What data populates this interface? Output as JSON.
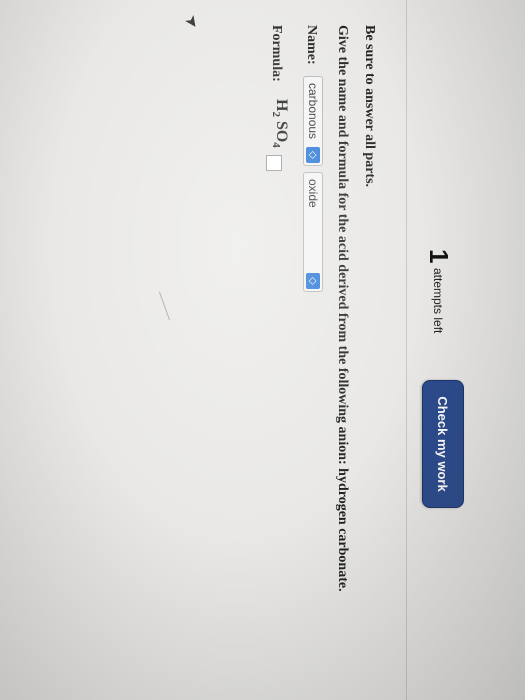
{
  "header": {
    "attempts_count": "1",
    "attempts_label": "attempts left",
    "check_label": "Check my work"
  },
  "instructions": "Be sure to answer all parts.",
  "question": "Give the name and formula for the acid derived from the following anion: hydrogen carbonate.",
  "name_row": {
    "label": "Name:",
    "select1_value": "carbonous",
    "select2_value": "oxide",
    "dropdown_glyph": "◇"
  },
  "formula_row": {
    "label": "Formula:",
    "symbol_h": "H",
    "sub_h": "2",
    "symbol_so": "SO",
    "sub_o": "4"
  },
  "colors": {
    "button_bg": "#2a4a8c",
    "dropdown_accent": "#2f7ad6",
    "text": "#222222"
  },
  "icons": [
    "dropdown-arrow-icon",
    "mouse-cursor-icon"
  ]
}
